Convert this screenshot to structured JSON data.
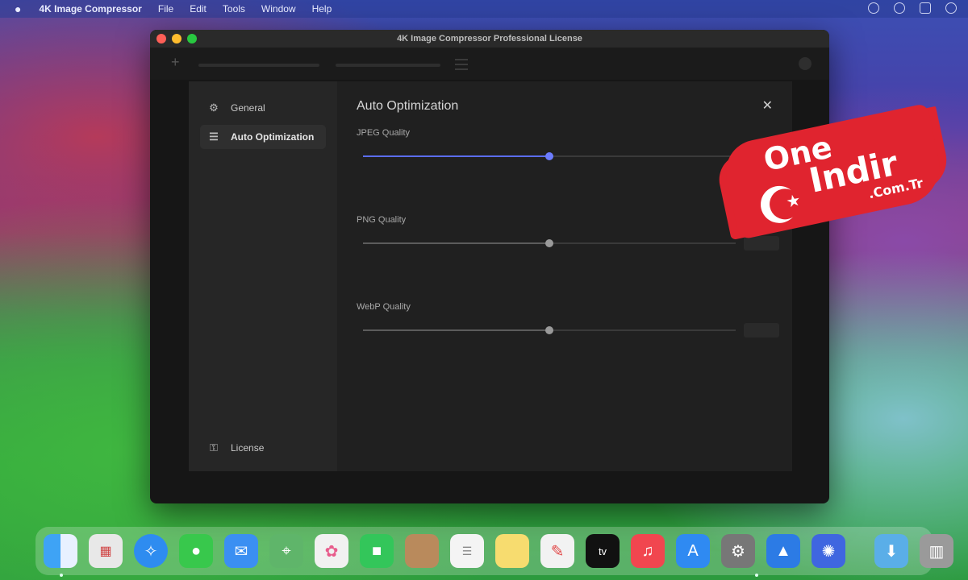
{
  "menubar": {
    "app_name": "4K Image Compressor",
    "menus": [
      "File",
      "Edit",
      "Tools",
      "Window",
      "Help"
    ]
  },
  "window": {
    "title": "4K Image Compressor Professional License"
  },
  "sidebar": {
    "items": [
      {
        "label": "General",
        "icon": "gear-icon"
      },
      {
        "label": "Auto Optimization",
        "icon": "sliders-icon"
      }
    ],
    "footer": {
      "label": "License",
      "icon": "key-icon"
    }
  },
  "content": {
    "title": "Auto Optimization",
    "sections": [
      {
        "label": "JPEG Quality",
        "value": 50,
        "value_text": "",
        "sub_option": ""
      },
      {
        "label": "PNG Quality",
        "value": 50,
        "value_text": "",
        "sub_option": ""
      },
      {
        "label": "WebP Quality",
        "value": 50,
        "value_text": "",
        "sub_option": ""
      }
    ]
  },
  "watermark": {
    "line1": "One",
    "line2": "Indir",
    "line3": ".Com.Tr"
  },
  "colors": {
    "accent": "#5b6df0",
    "window_bg": "#161616",
    "dialog_bg": "#202020",
    "watermark_red": "#e0242f"
  },
  "dock": {
    "icons": [
      "finder-icon",
      "launchpad-icon",
      "safari-icon",
      "messages-icon",
      "mail-icon",
      "maps-icon",
      "photos-icon",
      "facetime-icon",
      "contacts-icon",
      "reminders-icon",
      "notes-icon",
      "freeform-icon",
      "tv-icon",
      "music-icon",
      "app-store-icon",
      "system-settings-icon",
      "4k-image-compressor-icon",
      "app-icon",
      "downloads-folder-icon",
      "trash-icon"
    ]
  }
}
